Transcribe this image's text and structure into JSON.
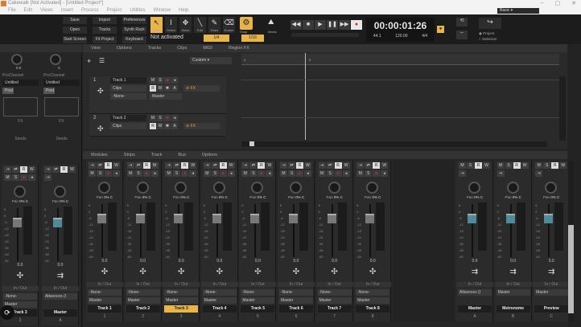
{
  "window": {
    "title": "Cakewalk [Not Activated] - [Untitled Project*]",
    "workspace": "Basic",
    "controls": [
      "–",
      "▢",
      "✕"
    ]
  },
  "menu": [
    "File",
    "Edit",
    "Views",
    "Insert",
    "Process",
    "Project",
    "Utilities",
    "Window",
    "Help"
  ],
  "toolbar": {
    "buttons": [
      [
        "Save",
        "Import",
        "Preferences"
      ],
      [
        "Open",
        "Tracks",
        "Synth Rack"
      ],
      [
        "Start Screen",
        "Fit Project",
        "Keyboard"
      ]
    ],
    "tools": [
      {
        "icon": "↖",
        "label": "Smart"
      },
      {
        "icon": "I",
        "label": "Select"
      },
      {
        "icon": "✥",
        "label": "Move"
      },
      {
        "icon": "╲",
        "label": "Edit"
      },
      {
        "icon": "✎",
        "label": "Draw"
      },
      {
        "icon": "⌫",
        "label": "Eraser"
      }
    ],
    "status": "Not activated",
    "snap_res": "1/4",
    "snap_label": "Snap",
    "snap_value": "1/16",
    "marks_label": "Marks",
    "transport": {
      "time": "00:00:01:26",
      "sample_rate": "44.1",
      "bit": "16",
      "tempo": "120.00",
      "meter": "4/4"
    },
    "export_options": [
      "Project",
      "Selection"
    ]
  },
  "trackview": {
    "menu": [
      "View",
      "Options",
      "Tracks",
      "Clips",
      "MIDI",
      "Region FX"
    ],
    "preset": "Custom",
    "ruler": [
      "1",
      "2"
    ],
    "tracks": [
      {
        "num": "1",
        "name": "Track 1",
        "clips": "Clips",
        "input": "-None-",
        "output": "Master",
        "fx": "FX"
      },
      {
        "num": "2",
        "name": "Track 2",
        "clips": "Clips",
        "fx": "FX"
      }
    ]
  },
  "inspector": {
    "gain": "0.0",
    "pan": "C",
    "prochannel": "ProChannel",
    "preset": "Untitled",
    "post": "Post",
    "fx": "FX",
    "sends": "Sends",
    "strips": [
      {
        "name": "Track 3",
        "pan": "0% C",
        "vol": "0.0",
        "in": "-None-",
        "out": "Master"
      },
      {
        "name": "Master",
        "pan": "0% C",
        "vol": "0.0",
        "out": "Altavoces (I"
      }
    ],
    "number": "3",
    "master_number": "A"
  },
  "console": {
    "menu": [
      "Modules",
      "Strips",
      "Track",
      "Bus",
      "Options"
    ],
    "io_label": "In / Out",
    "scale": [
      "6",
      "0",
      "-6",
      "-12",
      "-18",
      "-24",
      "-36",
      "-48",
      "-60"
    ],
    "strips": [
      {
        "name": "Track 1",
        "num": "1",
        "pan": "0% C",
        "vol": "0.0",
        "in": "-None-",
        "out": "Master",
        "type": "track"
      },
      {
        "name": "Track 2",
        "num": "2",
        "pan": "0% C",
        "vol": "0.0",
        "in": "-None-",
        "out": "Master",
        "type": "track"
      },
      {
        "name": "Track 3",
        "num": "3",
        "pan": "0% C",
        "vol": "0.0",
        "in": "-None-",
        "out": "Master",
        "type": "track",
        "selected": true
      },
      {
        "name": "Track 4",
        "num": "4",
        "pan": "0% C",
        "vol": "0.0",
        "in": "-None-",
        "out": "Master",
        "type": "track"
      },
      {
        "name": "Track 5",
        "num": "5",
        "pan": "0% C",
        "vol": "0.0",
        "in": "-None-",
        "out": "Master",
        "type": "track"
      },
      {
        "name": "Track 6",
        "num": "6",
        "pan": "0% C",
        "vol": "0.0",
        "in": "-None-",
        "out": "Master",
        "type": "track"
      },
      {
        "name": "Track 7",
        "num": "7",
        "pan": "0% C",
        "vol": "0.0",
        "in": "-None-",
        "out": "Master",
        "type": "track"
      },
      {
        "name": "Track 8",
        "num": "8",
        "pan": "0% C",
        "vol": "0.0",
        "in": "-None-",
        "out": "Master",
        "type": "track"
      }
    ],
    "buses": [
      {
        "name": "Master",
        "num": "A",
        "pan": "0% C",
        "vol": "0.0",
        "out": "Altavoces (I",
        "type": "bus"
      },
      {
        "name": "Metronome",
        "num": "B",
        "pan": "0% C",
        "vol": "0.0",
        "out": "Master",
        "type": "bus"
      },
      {
        "name": "Preview",
        "num": "C",
        "pan": "0% C",
        "vol": "0.0",
        "out": "Master",
        "type": "bus"
      }
    ]
  }
}
